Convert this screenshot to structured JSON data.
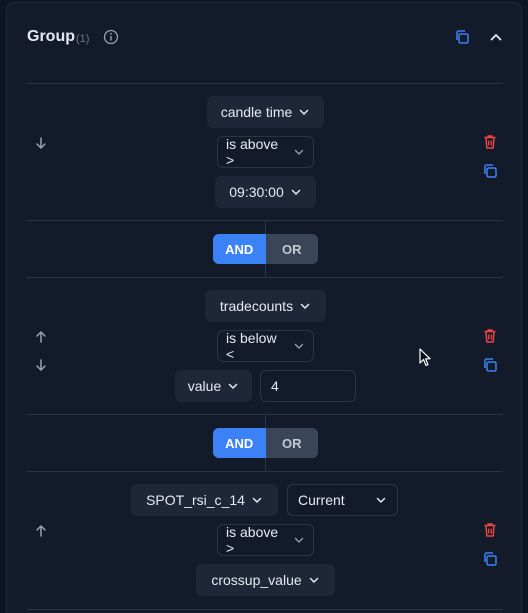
{
  "group": {
    "title": "Group",
    "count": "(1)"
  },
  "conditions": [
    {
      "field": "candle time",
      "operator": "is above >",
      "value": "09:30:00"
    },
    {
      "field": "tradecounts",
      "operator": "is below <",
      "value_type": "value",
      "value": "4"
    },
    {
      "field": "SPOT_rsi_c_14",
      "period": "Current",
      "operator": "is above >",
      "value": "crossup_value"
    }
  ],
  "connectors": [
    {
      "and_label": "AND",
      "or_label": "OR",
      "selected": "AND"
    },
    {
      "and_label": "AND",
      "or_label": "OR",
      "selected": "AND"
    }
  ],
  "colors": {
    "accent": "#3b82f6",
    "delete": "#ef4444",
    "copy": "#3b82f6",
    "background": "#131b2a"
  }
}
